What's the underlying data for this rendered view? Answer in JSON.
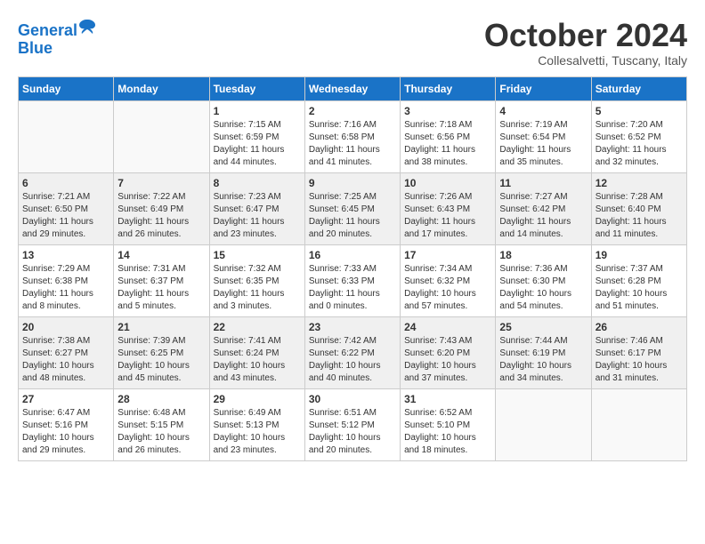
{
  "header": {
    "logo_line1": "General",
    "logo_line2": "Blue",
    "month_title": "October 2024",
    "subtitle": "Collesalvetti, Tuscany, Italy"
  },
  "days_of_week": [
    "Sunday",
    "Monday",
    "Tuesday",
    "Wednesday",
    "Thursday",
    "Friday",
    "Saturday"
  ],
  "weeks": [
    [
      {
        "day": "",
        "info": ""
      },
      {
        "day": "",
        "info": ""
      },
      {
        "day": "1",
        "info": "Sunrise: 7:15 AM\nSunset: 6:59 PM\nDaylight: 11 hours and 44 minutes."
      },
      {
        "day": "2",
        "info": "Sunrise: 7:16 AM\nSunset: 6:58 PM\nDaylight: 11 hours and 41 minutes."
      },
      {
        "day": "3",
        "info": "Sunrise: 7:18 AM\nSunset: 6:56 PM\nDaylight: 11 hours and 38 minutes."
      },
      {
        "day": "4",
        "info": "Sunrise: 7:19 AM\nSunset: 6:54 PM\nDaylight: 11 hours and 35 minutes."
      },
      {
        "day": "5",
        "info": "Sunrise: 7:20 AM\nSunset: 6:52 PM\nDaylight: 11 hours and 32 minutes."
      }
    ],
    [
      {
        "day": "6",
        "info": "Sunrise: 7:21 AM\nSunset: 6:50 PM\nDaylight: 11 hours and 29 minutes."
      },
      {
        "day": "7",
        "info": "Sunrise: 7:22 AM\nSunset: 6:49 PM\nDaylight: 11 hours and 26 minutes."
      },
      {
        "day": "8",
        "info": "Sunrise: 7:23 AM\nSunset: 6:47 PM\nDaylight: 11 hours and 23 minutes."
      },
      {
        "day": "9",
        "info": "Sunrise: 7:25 AM\nSunset: 6:45 PM\nDaylight: 11 hours and 20 minutes."
      },
      {
        "day": "10",
        "info": "Sunrise: 7:26 AM\nSunset: 6:43 PM\nDaylight: 11 hours and 17 minutes."
      },
      {
        "day": "11",
        "info": "Sunrise: 7:27 AM\nSunset: 6:42 PM\nDaylight: 11 hours and 14 minutes."
      },
      {
        "day": "12",
        "info": "Sunrise: 7:28 AM\nSunset: 6:40 PM\nDaylight: 11 hours and 11 minutes."
      }
    ],
    [
      {
        "day": "13",
        "info": "Sunrise: 7:29 AM\nSunset: 6:38 PM\nDaylight: 11 hours and 8 minutes."
      },
      {
        "day": "14",
        "info": "Sunrise: 7:31 AM\nSunset: 6:37 PM\nDaylight: 11 hours and 5 minutes."
      },
      {
        "day": "15",
        "info": "Sunrise: 7:32 AM\nSunset: 6:35 PM\nDaylight: 11 hours and 3 minutes."
      },
      {
        "day": "16",
        "info": "Sunrise: 7:33 AM\nSunset: 6:33 PM\nDaylight: 11 hours and 0 minutes."
      },
      {
        "day": "17",
        "info": "Sunrise: 7:34 AM\nSunset: 6:32 PM\nDaylight: 10 hours and 57 minutes."
      },
      {
        "day": "18",
        "info": "Sunrise: 7:36 AM\nSunset: 6:30 PM\nDaylight: 10 hours and 54 minutes."
      },
      {
        "day": "19",
        "info": "Sunrise: 7:37 AM\nSunset: 6:28 PM\nDaylight: 10 hours and 51 minutes."
      }
    ],
    [
      {
        "day": "20",
        "info": "Sunrise: 7:38 AM\nSunset: 6:27 PM\nDaylight: 10 hours and 48 minutes."
      },
      {
        "day": "21",
        "info": "Sunrise: 7:39 AM\nSunset: 6:25 PM\nDaylight: 10 hours and 45 minutes."
      },
      {
        "day": "22",
        "info": "Sunrise: 7:41 AM\nSunset: 6:24 PM\nDaylight: 10 hours and 43 minutes."
      },
      {
        "day": "23",
        "info": "Sunrise: 7:42 AM\nSunset: 6:22 PM\nDaylight: 10 hours and 40 minutes."
      },
      {
        "day": "24",
        "info": "Sunrise: 7:43 AM\nSunset: 6:20 PM\nDaylight: 10 hours and 37 minutes."
      },
      {
        "day": "25",
        "info": "Sunrise: 7:44 AM\nSunset: 6:19 PM\nDaylight: 10 hours and 34 minutes."
      },
      {
        "day": "26",
        "info": "Sunrise: 7:46 AM\nSunset: 6:17 PM\nDaylight: 10 hours and 31 minutes."
      }
    ],
    [
      {
        "day": "27",
        "info": "Sunrise: 6:47 AM\nSunset: 5:16 PM\nDaylight: 10 hours and 29 minutes."
      },
      {
        "day": "28",
        "info": "Sunrise: 6:48 AM\nSunset: 5:15 PM\nDaylight: 10 hours and 26 minutes."
      },
      {
        "day": "29",
        "info": "Sunrise: 6:49 AM\nSunset: 5:13 PM\nDaylight: 10 hours and 23 minutes."
      },
      {
        "day": "30",
        "info": "Sunrise: 6:51 AM\nSunset: 5:12 PM\nDaylight: 10 hours and 20 minutes."
      },
      {
        "day": "31",
        "info": "Sunrise: 6:52 AM\nSunset: 5:10 PM\nDaylight: 10 hours and 18 minutes."
      },
      {
        "day": "",
        "info": ""
      },
      {
        "day": "",
        "info": ""
      }
    ]
  ]
}
